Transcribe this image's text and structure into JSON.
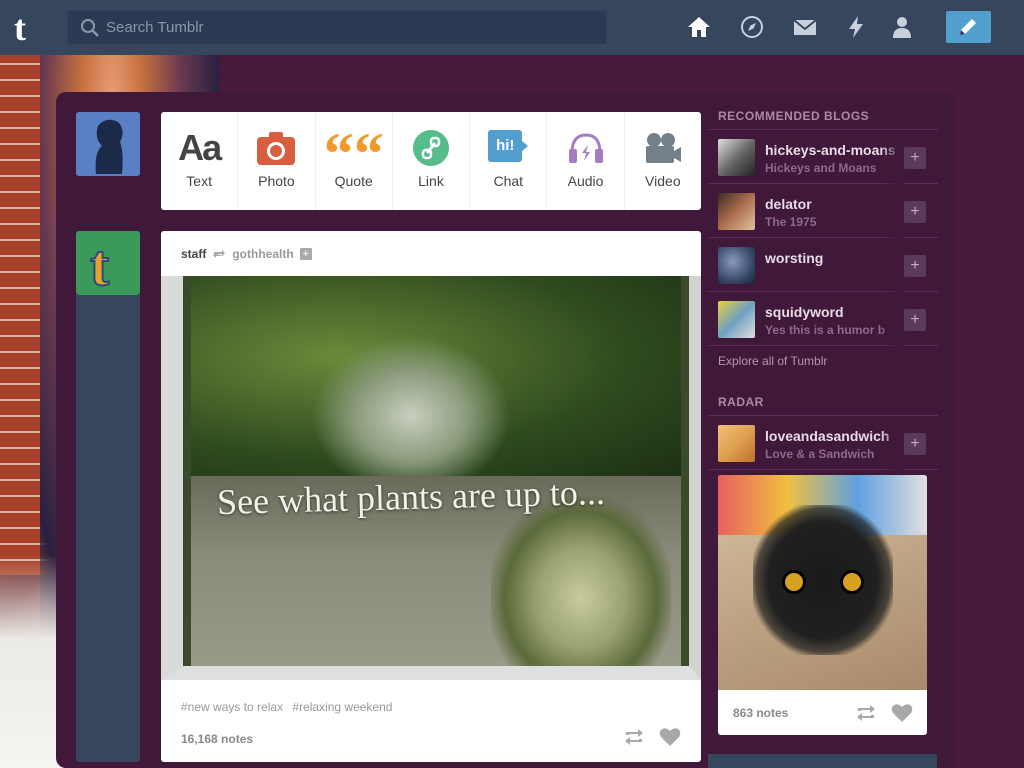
{
  "header": {
    "search_placeholder": "Search Tumblr"
  },
  "post_types": [
    {
      "icon": "text-icon",
      "glyph": "Aa",
      "label": "Text",
      "color": "#444444"
    },
    {
      "icon": "photo-icon",
      "label": "Photo",
      "color": "#d95e40"
    },
    {
      "icon": "quote-icon",
      "glyph": "““",
      "label": "Quote",
      "color": "#f2992e"
    },
    {
      "icon": "link-icon",
      "label": "Link",
      "color": "#56bc8a"
    },
    {
      "icon": "chat-icon",
      "glyph": "hi!",
      "label": "Chat",
      "color": "#529ecc"
    },
    {
      "icon": "audio-icon",
      "label": "Audio",
      "color": "#a77dc2"
    },
    {
      "icon": "video-icon",
      "label": "Video",
      "color": "#748089"
    }
  ],
  "post": {
    "user": "staff",
    "reblogged_from": "gothhealth",
    "image_caption": "See what plants are up to...",
    "tags": [
      "#new ways to relax",
      "#relaxing weekend"
    ],
    "notes": "16,168 notes"
  },
  "recommended": {
    "title": "RECOMMENDED BLOGS",
    "blogs": [
      {
        "name": "hickeys-and-moans",
        "desc": "Hickeys and Moans",
        "color": "#6a6a6a"
      },
      {
        "name": "delator",
        "desc": "The 1975",
        "color": "#b07050"
      },
      {
        "name": "worsting",
        "desc": "",
        "color": "#3a4a6a"
      },
      {
        "name": "squidyword",
        "desc": "Yes this is a humor b",
        "color": "#70a0c0"
      }
    ],
    "explore": "Explore all of Tumblr"
  },
  "radar": {
    "title": "RADAR",
    "blog": {
      "name": "loveandasandwich",
      "desc": "Love & a Sandwich",
      "color": "#e0a050"
    },
    "notes": "863 notes"
  }
}
